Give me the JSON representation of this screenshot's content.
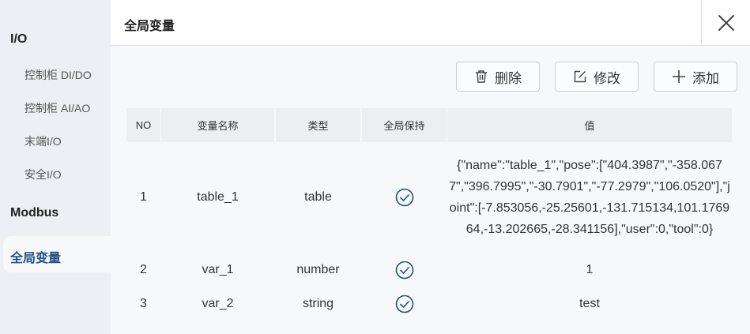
{
  "sidebar": {
    "io_title": "I/O",
    "items": [
      "控制柜 DI/DO",
      "控制柜 AI/AO",
      "末端I/O",
      "安全I/O"
    ],
    "modbus": "Modbus",
    "active": "全局变量"
  },
  "header": {
    "title": "全局变量"
  },
  "toolbar": {
    "delete": "删除",
    "edit": "修改",
    "add": "添加"
  },
  "table": {
    "columns": [
      "NO",
      "变量名称",
      "类型",
      "全局保持",
      "值"
    ],
    "rows": [
      {
        "no": "1",
        "name": "table_1",
        "type": "table",
        "global_keep": true,
        "value": "{\"name\":\"table_1\",\"pose\":[\"404.3987\",\"-358.0677\",\"396.7995\",\"-30.7901\",\"-77.2979\",\"106.0520\"],\"joint\":[-7.853056,-25.25601,-131.715134,101.176964,-13.202665,-28.341156],\"user\":0,\"tool\":0}"
      },
      {
        "no": "2",
        "name": "var_1",
        "type": "number",
        "global_keep": true,
        "value": "1"
      },
      {
        "no": "3",
        "name": "var_2",
        "type": "string",
        "global_keep": true,
        "value": "test"
      }
    ]
  },
  "colors": {
    "accent": "#1f4f86",
    "check": "#1f4f86"
  }
}
